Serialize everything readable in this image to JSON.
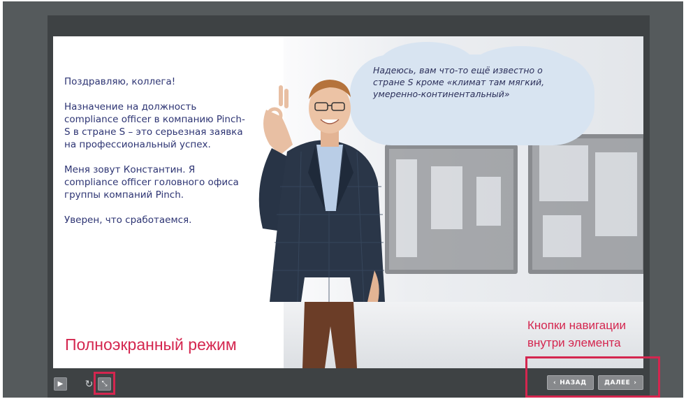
{
  "slide": {
    "intro_paragraphs": [
      "Поздравляю, коллега!",
      "Назначение на должность compliance officer в компанию Pinch-S в стране S – это серьезная заявка на профессиональный успех.",
      "Меня зовут Константин. Я compliance officer головного офиса группы компаний Pinch.",
      "Уверен, что сработаемся."
    ],
    "speech_bubble": "Надеюсь, вам что-то ещё известно о стране S кроме «климат там мягкий, умеренно-континентальный»"
  },
  "annotations": {
    "fullscreen_label": "Полноэкранный режим",
    "nav_label": "Кнопки навигации внутри элемента",
    "highlight_color": "#d4264f"
  },
  "controls": {
    "play_icon": "play-icon",
    "replay_icon": "replay-icon",
    "fullscreen_icon": "fullscreen-icon",
    "back_label": "НАЗАД",
    "next_label": "ДАЛЕЕ"
  },
  "colors": {
    "text": "#2d3473",
    "bubble": "#d8e4f1",
    "frame": "#3e4244"
  }
}
